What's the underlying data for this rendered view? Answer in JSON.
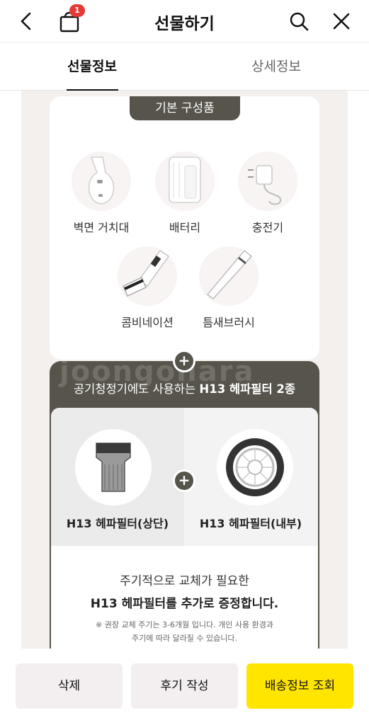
{
  "header": {
    "title": "선물하기",
    "cart_badge": "1",
    "icons": [
      "back-arrow-icon",
      "shopping-bag-icon",
      "search-icon",
      "close-icon"
    ]
  },
  "tabs": [
    {
      "label": "선물정보",
      "active": true
    },
    {
      "label": "상세정보",
      "active": false
    }
  ],
  "basic_components": {
    "tag": "기본 구성품",
    "items": [
      {
        "label": "벽면 거치대"
      },
      {
        "label": "배터리"
      },
      {
        "label": "충전기"
      },
      {
        "label": "콤비네이션"
      },
      {
        "label": "틈새브러시"
      }
    ]
  },
  "filter_promo": {
    "watermark": "joongonara",
    "headline_prefix": "공기청정기에도 사용하는 ",
    "headline_bold": "H13 헤파필터 2종",
    "filters": [
      {
        "label": "H13 헤파필터(상단)"
      },
      {
        "label": "H13 헤파필터(내부)"
      }
    ],
    "desc_line1": "주기적으로 교체가 필요한",
    "desc_line2": "H13 헤파필터를 추가로 증정합니다.",
    "note_line1": "※ 권장 교체 주기는 3-6개월 입니다. 개인 사용 환경과",
    "note_line2": "주기에 따라 달라질 수 있습니다."
  },
  "bottom_bar": {
    "delete_label": "삭제",
    "review_label": "후기 작성",
    "shipping_label": "배송정보 조회"
  },
  "colors": {
    "accent_yellow": "#ffe500",
    "badge_red": "#e53935",
    "dark_panel": "#57544b"
  }
}
